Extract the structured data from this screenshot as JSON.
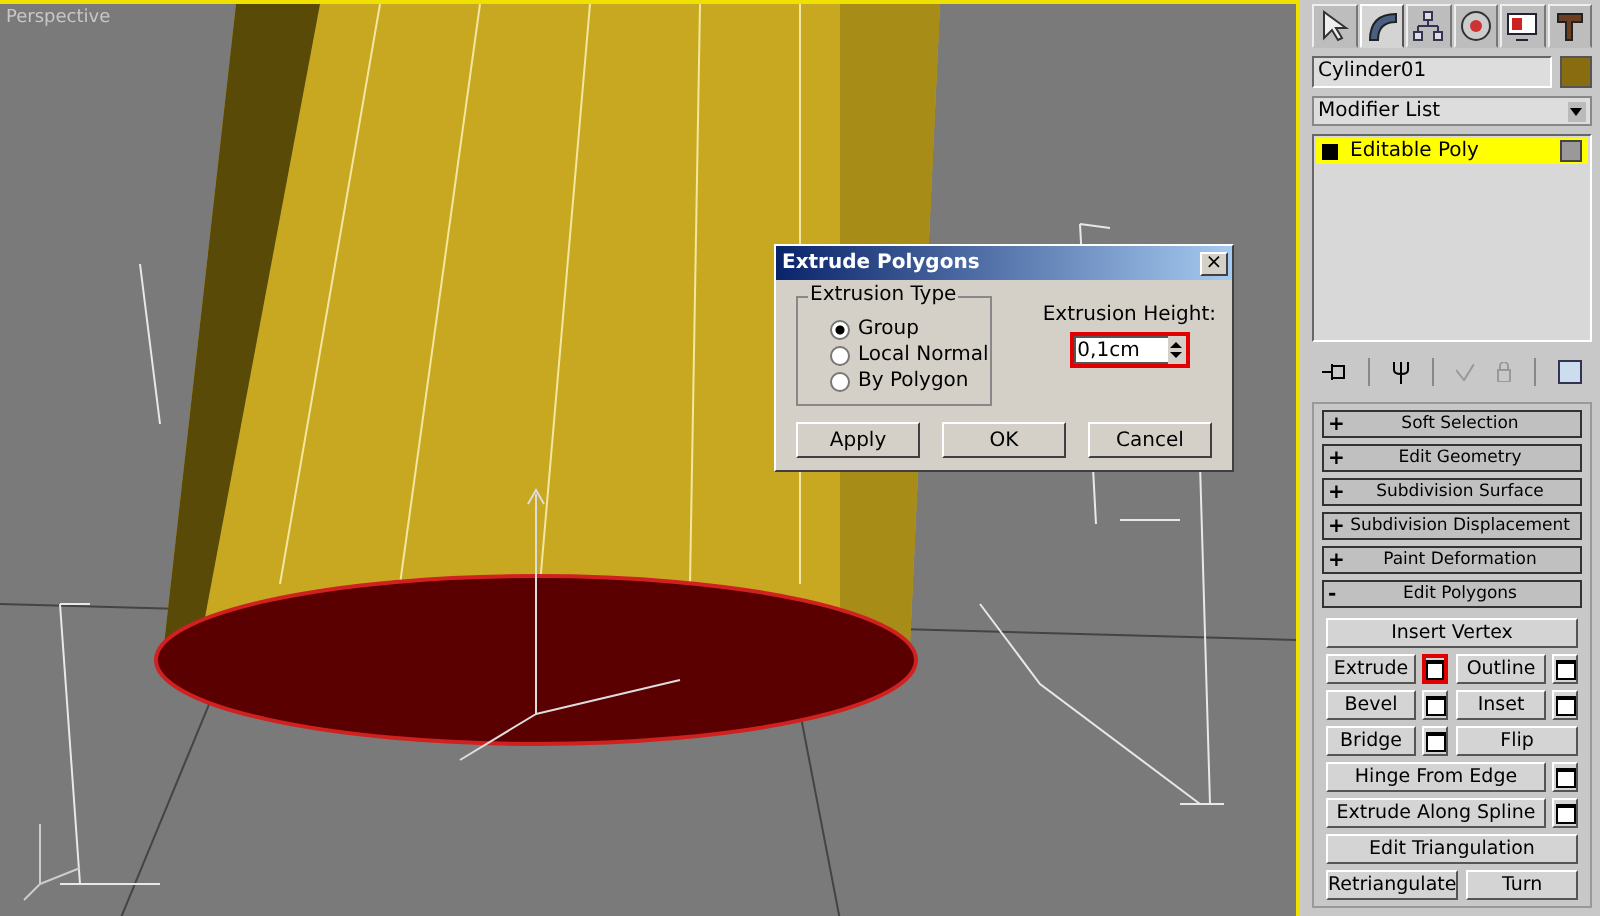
{
  "viewport": {
    "label": "Perspective"
  },
  "dialog": {
    "title": "Extrude Polygons",
    "close": "×",
    "group_label": "Extrusion Type",
    "options": [
      {
        "label": "Group",
        "selected": true
      },
      {
        "label": "Local Normal",
        "selected": false
      },
      {
        "label": "By Polygon",
        "selected": false
      }
    ],
    "height_label": "Extrusion Height:",
    "height_value": "0,1cm",
    "height_highlighted": true,
    "buttons": [
      "Apply",
      "OK",
      "Cancel"
    ]
  },
  "panel": {
    "tabs": [
      {
        "selected": false
      },
      {
        "selected": true
      },
      {
        "selected": false
      },
      {
        "selected": false
      },
      {
        "selected": false
      },
      {
        "selected": false
      }
    ],
    "object_name": "Cylinder01",
    "modifier_list": "Modifier List",
    "stack": [
      {
        "label": "Editable Poly",
        "selected": true
      }
    ],
    "rollouts": [
      {
        "label": "Soft Selection",
        "expanded": false
      },
      {
        "label": "Edit Geometry",
        "expanded": false
      },
      {
        "label": "Subdivision Surface",
        "expanded": false
      },
      {
        "label": "Subdivision Displacement",
        "expanded": false
      },
      {
        "label": "Paint Deformation",
        "expanded": false
      },
      {
        "label": "Edit Polygons",
        "expanded": true
      }
    ],
    "expand_sign": "+",
    "collapse_sign": "-",
    "button_rows": [
      [
        {
          "label": "Insert Vertex",
          "kind": "plain",
          "highlighted": false
        }
      ],
      [
        {
          "label": "Extrude",
          "kind": "settings",
          "highlighted": true
        },
        {
          "label": "Outline",
          "kind": "settings",
          "highlighted": false
        }
      ],
      [
        {
          "label": "Bevel",
          "kind": "settings",
          "highlighted": false
        },
        {
          "label": "Inset",
          "kind": "settings",
          "highlighted": false
        }
      ],
      [
        {
          "label": "Bridge",
          "kind": "settings",
          "highlighted": false
        },
        {
          "label": "Flip",
          "kind": "plain",
          "highlighted": false
        }
      ],
      [
        {
          "label": "Hinge From Edge",
          "kind": "settings",
          "highlighted": false
        }
      ],
      [
        {
          "label": "Extrude Along Spline",
          "kind": "settings",
          "highlighted": false
        }
      ],
      [
        {
          "label": "Edit Triangulation",
          "kind": "plain",
          "highlighted": false
        }
      ],
      [
        {
          "label": "Retriangulate",
          "kind": "plain",
          "highlighted": false
        },
        {
          "label": "Turn",
          "kind": "plain",
          "highlighted": false
        }
      ]
    ]
  }
}
